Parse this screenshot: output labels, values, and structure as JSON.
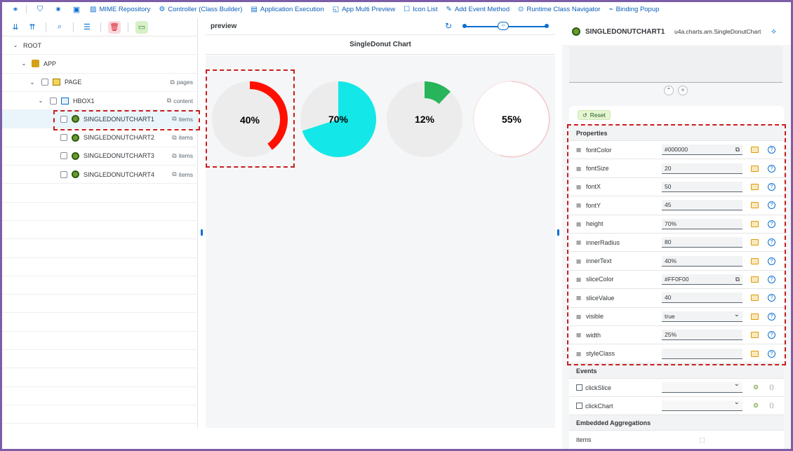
{
  "toolbar": {
    "icons": [
      "link-icon",
      "shield-icon",
      "magic-icon",
      "save-icon"
    ],
    "items": [
      {
        "label": "MIME Repository",
        "icon": "image-icon"
      },
      {
        "label": "Controller (Class Builder)",
        "icon": "gear-icon"
      },
      {
        "label": "Application Execution",
        "icon": "run-icon"
      },
      {
        "label": "App Multi Preview",
        "icon": "preview-icon"
      },
      {
        "label": "Icon List",
        "icon": "list-icon"
      },
      {
        "label": "Add Event Method",
        "icon": "event-icon"
      },
      {
        "label": "Runtime Class Navigator",
        "icon": "navigator-icon"
      },
      {
        "label": "Binding Popup",
        "icon": "binding-icon"
      }
    ]
  },
  "tree": {
    "rows": [
      {
        "label": "ROOT",
        "aggregation": ""
      },
      {
        "label": "APP",
        "aggregation": ""
      },
      {
        "label": "PAGE",
        "aggregation": "pages"
      },
      {
        "label": "HBOX1",
        "aggregation": "content"
      },
      {
        "label": "SINGLEDONUTCHART1",
        "aggregation": "items"
      },
      {
        "label": "SINGLEDONUTCHART2",
        "aggregation": "items"
      },
      {
        "label": "SINGLEDONUTCHART3",
        "aggregation": "items"
      },
      {
        "label": "SINGLEDONUTCHART4",
        "aggregation": "items"
      }
    ]
  },
  "preview": {
    "header": "preview",
    "title": "SingleDonut Chart",
    "zoom_fraction": 0.5
  },
  "chart_data": {
    "type": "pie",
    "charts": [
      {
        "name": "SINGLEDONUTCHART1",
        "label": "40%",
        "value": 40,
        "color": "#FF0F00",
        "track": "#ececec"
      },
      {
        "name": "SINGLEDONUTCHART2",
        "label": "70%",
        "value": 70,
        "color": "#14e7e7",
        "track": "#ececec"
      },
      {
        "name": "SINGLEDONUTCHART3",
        "label": "12%",
        "value": 12,
        "color": "#27b45a",
        "track": "#ececec"
      },
      {
        "name": "SINGLEDONUTCHART4",
        "label": "55%",
        "value": 55,
        "color": "#f2c4c4",
        "track": "#ffffff"
      }
    ]
  },
  "inspector": {
    "title": "SINGLEDONUTCHART1",
    "class_name": "u4a.charts.am.SingleDonutChart",
    "reset_label": "Reset",
    "properties_title": "Properties",
    "properties": [
      {
        "name": "fontColor",
        "value": "#000000",
        "kind": "copy"
      },
      {
        "name": "fontSize",
        "value": "20",
        "kind": "text"
      },
      {
        "name": "fontX",
        "value": "50",
        "kind": "text"
      },
      {
        "name": "fontY",
        "value": "45",
        "kind": "text"
      },
      {
        "name": "height",
        "value": "70%",
        "kind": "text"
      },
      {
        "name": "innerRadius",
        "value": "80",
        "kind": "text"
      },
      {
        "name": "innerText",
        "value": "40%",
        "kind": "text"
      },
      {
        "name": "sliceColor",
        "value": "#FF0F00",
        "kind": "copy"
      },
      {
        "name": "sliceValue",
        "value": "40",
        "kind": "text"
      },
      {
        "name": "visible",
        "value": "true",
        "kind": "select"
      },
      {
        "name": "width",
        "value": "25%",
        "kind": "text"
      },
      {
        "name": "styleClass",
        "value": "",
        "kind": "text"
      }
    ],
    "events_title": "Events",
    "events": [
      {
        "name": "clickSlice",
        "value": ""
      },
      {
        "name": "clickChart",
        "value": ""
      }
    ],
    "aggregations_title": "Embedded Aggregations",
    "aggregations": [
      {
        "name": "items"
      }
    ]
  }
}
